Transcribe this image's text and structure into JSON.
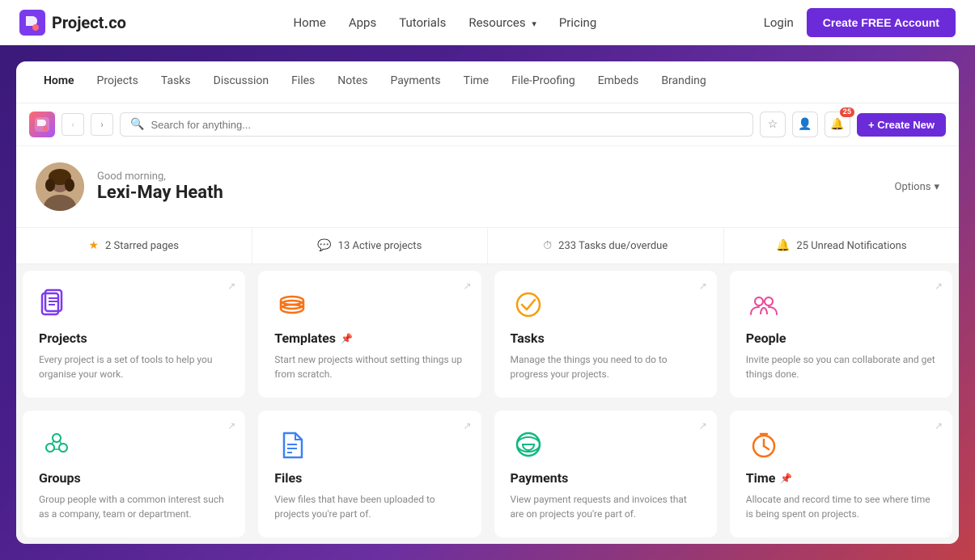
{
  "nav": {
    "logo_text": "Project.co",
    "links": [
      {
        "label": "Home",
        "id": "home"
      },
      {
        "label": "Apps",
        "id": "apps"
      },
      {
        "label": "Tutorials",
        "id": "tutorials"
      },
      {
        "label": "Resources",
        "id": "resources",
        "has_arrow": true
      },
      {
        "label": "Pricing",
        "id": "pricing"
      }
    ],
    "login_label": "Login",
    "create_account_label": "Create FREE Account"
  },
  "tabs": [
    {
      "label": "Home",
      "active": true
    },
    {
      "label": "Projects",
      "active": false
    },
    {
      "label": "Tasks",
      "active": false
    },
    {
      "label": "Discussion",
      "active": false
    },
    {
      "label": "Files",
      "active": false
    },
    {
      "label": "Notes",
      "active": false
    },
    {
      "label": "Payments",
      "active": false
    },
    {
      "label": "Time",
      "active": false
    },
    {
      "label": "File-Proofing",
      "active": false
    },
    {
      "label": "Embeds",
      "active": false
    },
    {
      "label": "Branding",
      "active": false
    }
  ],
  "toolbar": {
    "search_placeholder": "Search for anything...",
    "notification_count": "25",
    "create_new_label": "+ Create New"
  },
  "welcome": {
    "greeting": "Good morning,",
    "name": "Lexi-May Heath",
    "options_label": "Options"
  },
  "stats": [
    {
      "icon": "star",
      "label": "2 Starred pages"
    },
    {
      "icon": "chat",
      "label": "13 Active projects"
    },
    {
      "icon": "clock",
      "label": "233 Tasks due/overdue"
    },
    {
      "icon": "bell",
      "label": "25 Unread Notifications"
    }
  ],
  "cards": [
    {
      "id": "projects",
      "title": "Projects",
      "desc": "Every project is a set of tools to help you organise your work.",
      "icon_type": "projects"
    },
    {
      "id": "templates",
      "title": "Templates",
      "desc": "Start new projects without setting things up from scratch.",
      "icon_type": "templates",
      "has_pin": true
    },
    {
      "id": "tasks",
      "title": "Tasks",
      "desc": "Manage the things you need to do to progress your projects.",
      "icon_type": "tasks"
    },
    {
      "id": "people",
      "title": "People",
      "desc": "Invite people so you can collaborate and get things done.",
      "icon_type": "people"
    },
    {
      "id": "groups",
      "title": "Groups",
      "desc": "Group people with a common interest such as a company, team or department.",
      "icon_type": "groups"
    },
    {
      "id": "files",
      "title": "Files",
      "desc": "View files that have been uploaded to projects you're part of.",
      "icon_type": "files"
    },
    {
      "id": "payments",
      "title": "Payments",
      "desc": "View payment requests and invoices that are on projects you're part of.",
      "icon_type": "payments"
    },
    {
      "id": "time",
      "title": "Time",
      "desc": "Allocate and record time to see where time is being spent on projects.",
      "icon_type": "time",
      "has_pin": true
    }
  ]
}
